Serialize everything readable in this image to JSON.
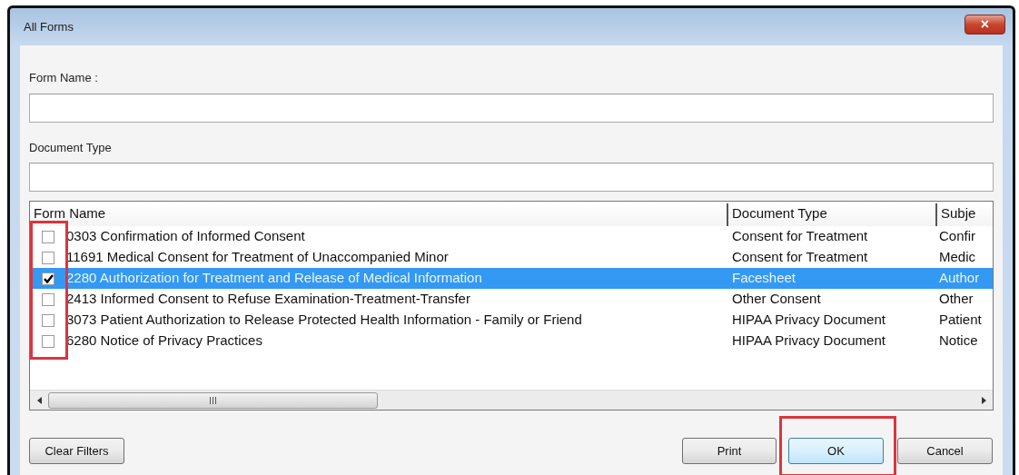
{
  "window": {
    "title": "All Forms",
    "close": "×"
  },
  "filters": [
    {
      "label": "Form Name :"
    },
    {
      "label": "Document Type"
    }
  ],
  "table": {
    "columns": [
      "Form Name",
      "Document Type",
      "Subje"
    ],
    "checkbox_column_highlighted": true,
    "rows": [
      {
        "checked": false,
        "selected": false,
        "cells": [
          "0303 Confirmation of Informed Consent",
          "Consent for Treatment",
          "Confir"
        ]
      },
      {
        "checked": false,
        "selected": false,
        "cells": [
          "11691 Medical Consent for Treatment of Unaccompanied Minor",
          "Consent for Treatment",
          "Medic"
        ]
      },
      {
        "checked": true,
        "selected": true,
        "cells": [
          "2280 Authorization for Treatment and Release of Medical Information",
          "Facesheet",
          "Author"
        ]
      },
      {
        "checked": false,
        "selected": false,
        "cells": [
          "2413 Informed Consent to Refuse Examination-Treatment-Transfer",
          "Other Consent",
          "Other"
        ]
      },
      {
        "checked": false,
        "selected": false,
        "cells": [
          "3073 Patient Authorization to Release Protected Health Information - Family or Friend",
          "HIPAA Privacy Document",
          "Patient"
        ]
      },
      {
        "checked": false,
        "selected": false,
        "cells": [
          "6280 Notice of Privacy Practices",
          "HIPAA Privacy Document",
          "Notice"
        ]
      }
    ]
  },
  "buttons": [
    {
      "label": "Clear Filters",
      "highlighted": false,
      "default": false
    },
    {
      "label": "Print",
      "highlighted": false,
      "default": false
    },
    {
      "label": "OK",
      "highlighted": true,
      "default": true
    },
    {
      "label": "Cancel",
      "highlighted": false,
      "default": false
    }
  ]
}
